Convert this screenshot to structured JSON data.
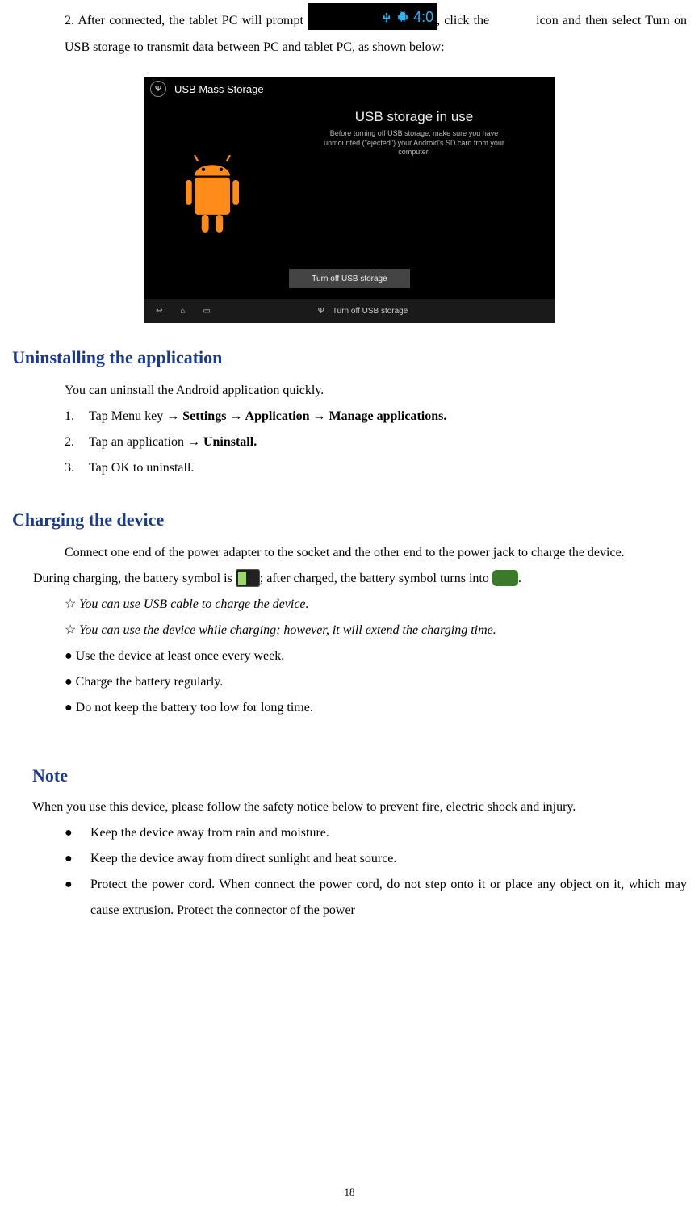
{
  "para1": {
    "a": "2. After connected, the tablet PC will prompt",
    "b": ", click the",
    "c": "icon",
    "d": "and then select Turn on USB storage to transmit data between PC and tablet PC, as shown below:"
  },
  "statusbar_time": "4:0",
  "screenshot": {
    "title": "USB Mass Storage",
    "main_label": "USB storage in use",
    "sub1": "Before turning off USB storage, make sure you have",
    "sub2": "unmounted (\"ejected\") your Android's SD card from your",
    "sub3": "computer.",
    "btn": "Turn off USB storage",
    "nav_text": "Turn off USB storage"
  },
  "h1": "Uninstalling the application",
  "uninstall_intro": "You can uninstall the Android application quickly.",
  "steps": {
    "n1": "1.",
    "t1a": "Tap Menu key → ",
    "t1b": "Settings → Application → Manage applications.",
    "n2": "2.",
    "t2a": "Tap an application → ",
    "t2b": "Uninstall.",
    "n3": "3.",
    "t3": "Tap OK to uninstall."
  },
  "h2": "Charging the device",
  "charge_intro": "Connect one end of the power adapter to the socket and the other end to the power jack to charge the device.",
  "charge_line": {
    "a": "During charging, the battery symbol is",
    "b": "; after charged, the battery symbol turns into ",
    "c": "."
  },
  "tips": {
    "star": "☆",
    "t1": " You can use USB cable to charge the device.",
    "t2": " You can use the device while charging; however, it will extend the charging time.",
    "dot": "●",
    "b1": " Use the device at least once every week.",
    "b2": " Charge the battery regularly.",
    "b3": " Do not keep the battery too low for long time."
  },
  "h3": "Note",
  "note_intro": "When you use this device, please follow the safety notice below to prevent fire, electric shock and injury.",
  "notes": {
    "dot": "●",
    "n1": "Keep the device away from rain and moisture.",
    "n2": "Keep the device away from direct sunlight and heat source.",
    "n3": "Protect the power cord. When connect the power cord, do not step onto it or place any object on it, which may cause extrusion. Protect the connector of the power"
  },
  "page_number": "18"
}
